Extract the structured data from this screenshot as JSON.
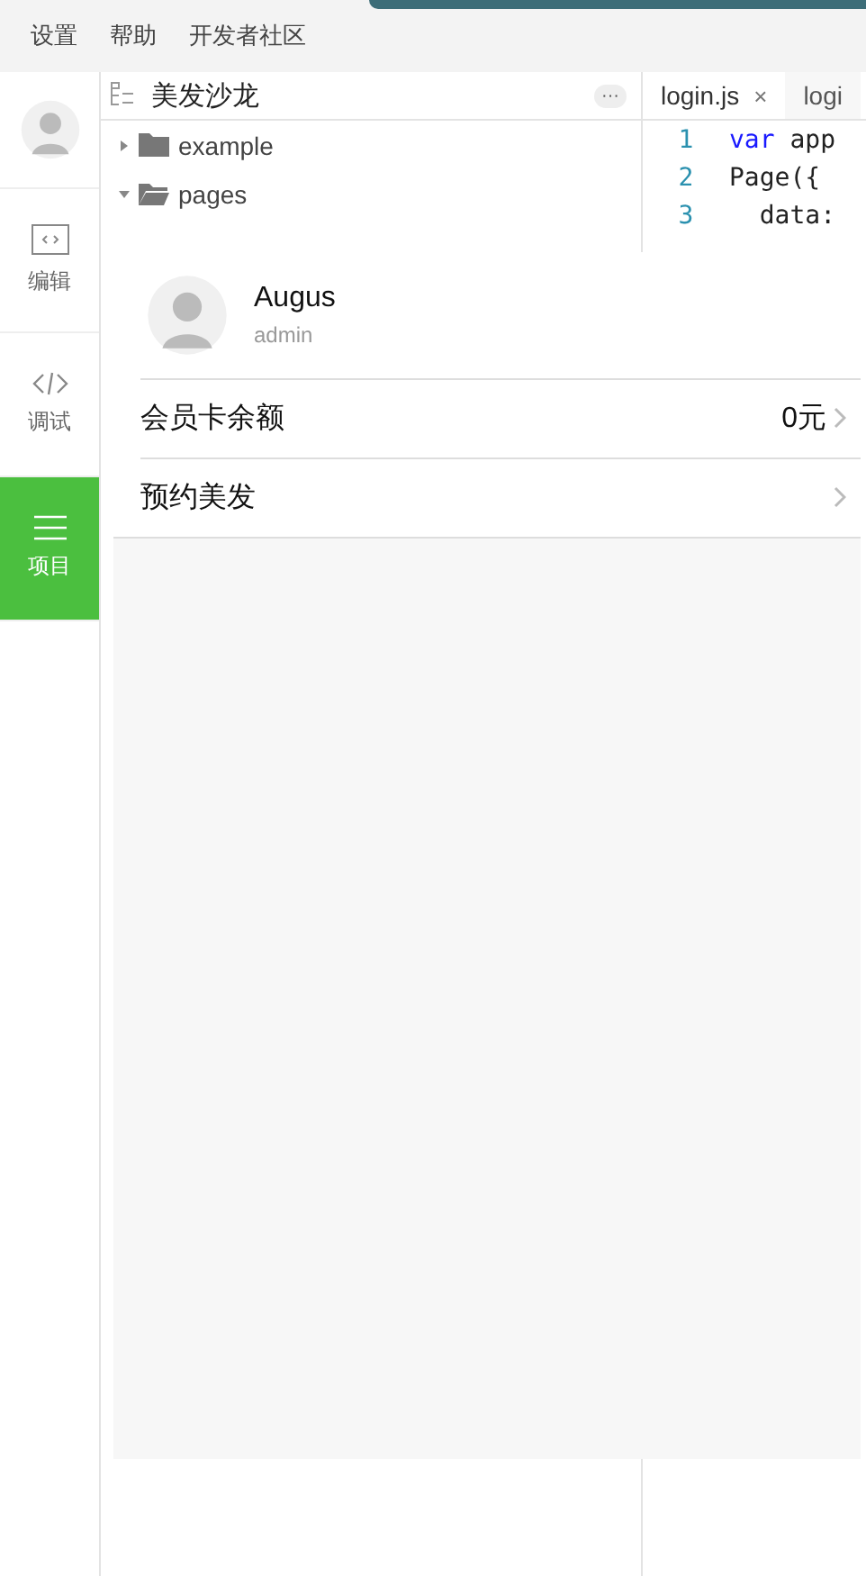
{
  "menu": [
    "设置",
    "帮助",
    "开发者社区"
  ],
  "activity_bar": [
    {
      "kind": "avatar",
      "selected": false
    },
    {
      "kind": "editor",
      "label": "编辑",
      "selected": false
    },
    {
      "kind": "debug",
      "label": "调试",
      "selected": false
    },
    {
      "kind": "project",
      "label": "项目",
      "selected": true
    }
  ],
  "explorer": {
    "title": "美发沙龙",
    "more": "···",
    "tree": [
      {
        "label": "example",
        "expanded": false
      },
      {
        "label": "pages",
        "expanded": true
      }
    ]
  },
  "editor": {
    "tabs": [
      {
        "label": "login.js",
        "close": "×",
        "selected": true
      },
      {
        "label": "logi",
        "selected": false
      }
    ],
    "lines": [
      {
        "number": "1",
        "tokens": [
          {
            "text": "var",
            "kind": "keyword"
          },
          {
            "text": " app",
            "kind": "plain"
          }
        ]
      },
      {
        "number": "2",
        "tokens": [
          {
            "text": "Page({",
            "kind": "plain"
          }
        ]
      },
      {
        "number": "3",
        "tokens": [
          {
            "text": "  data:",
            "kind": "plain"
          }
        ]
      }
    ]
  },
  "simulator": {
    "profile": {
      "name": "Augus",
      "role": "admin"
    },
    "rows": [
      {
        "label": "会员卡余额",
        "value": "0元"
      },
      {
        "label": "预约美发"
      }
    ]
  }
}
